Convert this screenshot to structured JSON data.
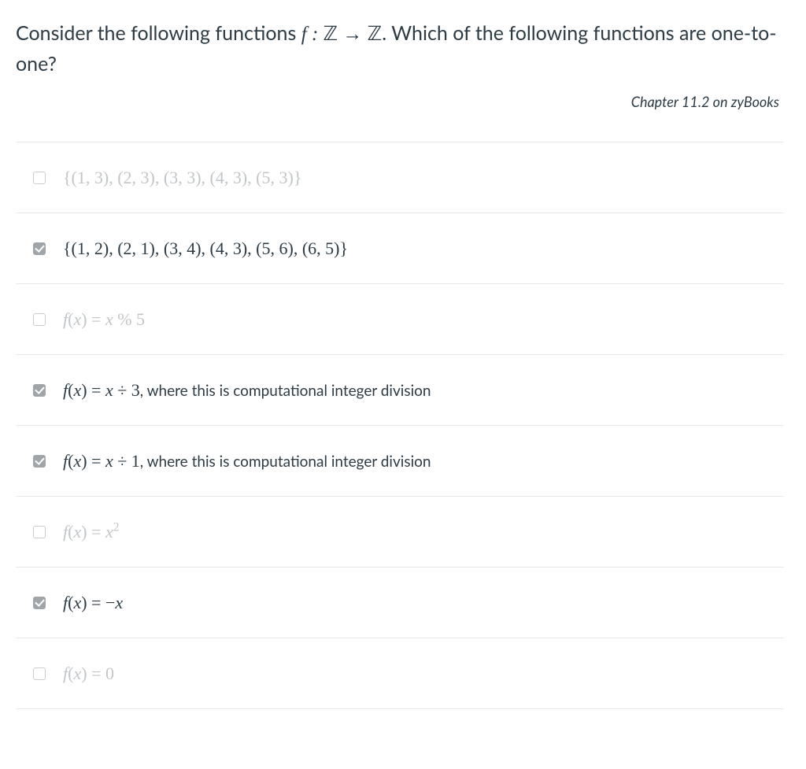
{
  "question": {
    "prefix": "Consider the following functions ",
    "func": "f : ℤ → ℤ",
    "suffix": ". Which of the following functions are one-to-one?"
  },
  "reference": "Chapter 11.2 on zyBooks",
  "answers": [
    {
      "checked": false,
      "dimmed": true,
      "set_text": "{(1, 3), (2, 3), (3, 3), (4, 3), (5, 3)}"
    },
    {
      "checked": true,
      "dimmed": false,
      "set_text": "{(1, 2), (2, 1), (3, 4), (4, 3), (5, 6), (6, 5)}"
    },
    {
      "checked": false,
      "dimmed": true,
      "formula_html": "<span class='mi'>f</span>(<span class='mi'>x</span>) = <span class='mi'>x</span> % 5"
    },
    {
      "checked": true,
      "dimmed": false,
      "formula_html": "<span class='mi'>f</span>(<span class='mi'>x</span>) = <span class='mi'>x</span> ÷ 3",
      "suffix": ", where this is computational integer division"
    },
    {
      "checked": true,
      "dimmed": false,
      "formula_html": "<span class='mi'>f</span>(<span class='mi'>x</span>) = <span class='mi'>x</span> ÷ 1",
      "suffix": ", where this is computational integer division"
    },
    {
      "checked": false,
      "dimmed": true,
      "formula_html": "<span class='mi'>f</span>(<span class='mi'>x</span>) = <span class='mi'>x</span><sup>2</sup>"
    },
    {
      "checked": true,
      "dimmed": false,
      "formula_html": "<span class='mi'>f</span>(<span class='mi'>x</span>) = −<span class='mi'>x</span>"
    },
    {
      "checked": false,
      "dimmed": true,
      "formula_html": "<span class='mi'>f</span>(<span class='mi'>x</span>) = 0"
    }
  ]
}
